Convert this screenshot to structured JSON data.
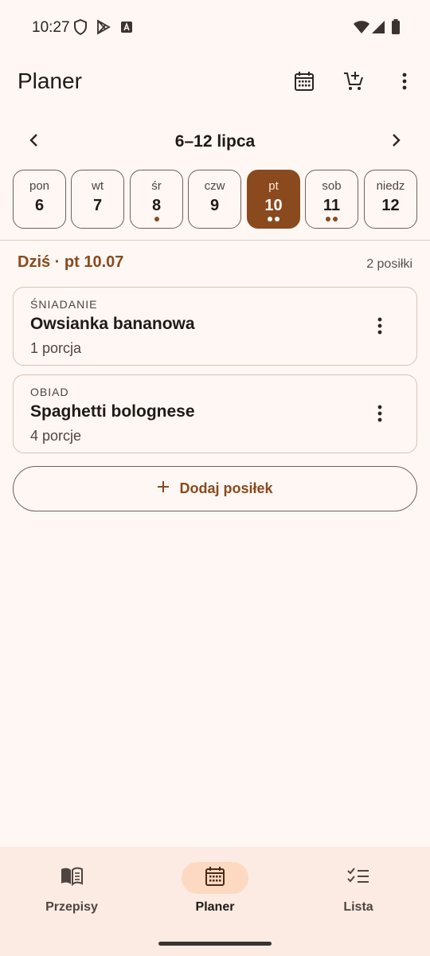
{
  "status_bar": {
    "time": "10:27",
    "icons": [
      "shield-icon",
      "play-store-icon",
      "font-icon",
      "wifi-icon",
      "signal-icon",
      "battery-icon"
    ]
  },
  "app_bar": {
    "title": "Planer",
    "actions": [
      "calendar-icon",
      "add-to-cart-icon",
      "more-vert-icon"
    ]
  },
  "week": {
    "label": "6–12 lipca",
    "days": [
      {
        "name": "pon",
        "num": "6",
        "meals": 0,
        "selected": false
      },
      {
        "name": "wt",
        "num": "7",
        "meals": 0,
        "selected": false
      },
      {
        "name": "śr",
        "num": "8",
        "meals": 1,
        "selected": false
      },
      {
        "name": "czw",
        "num": "9",
        "meals": 0,
        "selected": false
      },
      {
        "name": "pt",
        "num": "10",
        "meals": 2,
        "selected": true
      },
      {
        "name": "sob",
        "num": "11",
        "meals": 2,
        "selected": false
      },
      {
        "name": "niedz",
        "num": "12",
        "meals": 0,
        "selected": false
      }
    ]
  },
  "today": {
    "label": "Dziś · pt 10.07",
    "count": "2 posiłki"
  },
  "meals": [
    {
      "type": "ŚNIADANIE",
      "name": "Owsianka bananowa",
      "portions": "1 porcja"
    },
    {
      "type": "OBIAD",
      "name": "Spaghetti bolognese",
      "portions": "4 porcje"
    }
  ],
  "add_meal": {
    "label": "Dodaj posiłek"
  },
  "bottom_nav": {
    "items": [
      {
        "label": "Przepisy",
        "icon": "book-icon",
        "active": false
      },
      {
        "label": "Planer",
        "icon": "calendar-icon",
        "active": true
      },
      {
        "label": "Lista",
        "icon": "checklist-icon",
        "active": false
      }
    ]
  },
  "colors": {
    "background": "#fff7f3",
    "accent": "#8a4a1d",
    "nav_background": "#fbebe2",
    "nav_active_pill": "#fdd9c2"
  }
}
